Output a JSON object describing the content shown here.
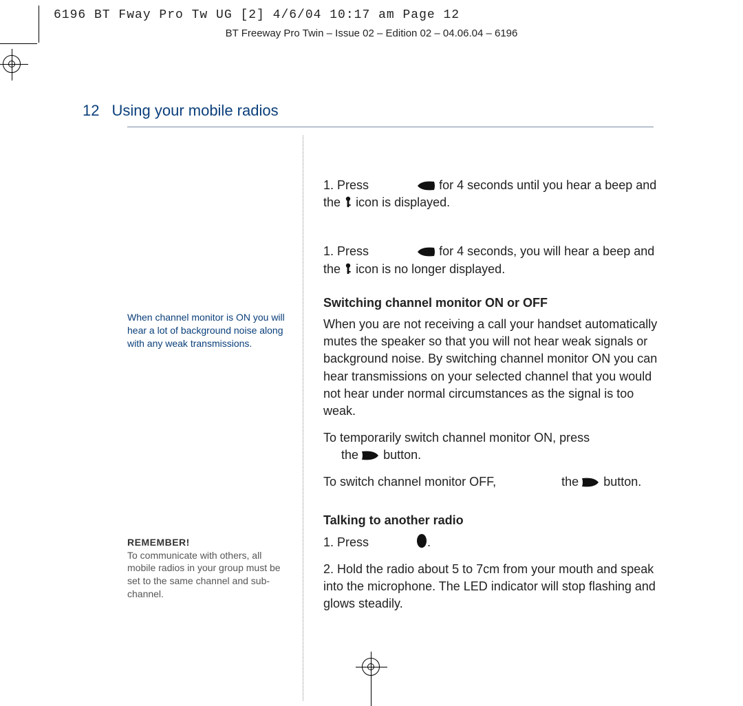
{
  "print": {
    "slug": "6196 BT Fway Pro Tw UG [2]  4/6/04  10:17 am  Page 12",
    "header": "BT Freeway Pro Twin – Issue 02 – Edition 02 – 04.06.04 – 6196"
  },
  "page": {
    "number": "12",
    "section_title": "Using your mobile radios"
  },
  "sidebar": {
    "note1": "When channel monitor is ON you will hear a lot of background noise along with any weak transmissions.",
    "remember_title": "REMEMBER!",
    "remember_body": "To communicate with others, all mobile radios in your group must be set to the same channel and sub-channel."
  },
  "main": {
    "step1a_prefix": "1. Press",
    "step1a_mid": "for 4 seconds until you hear a beep and the",
    "step1a_suffix": "icon is displayed.",
    "step1b_prefix": "1. Press",
    "step1b_mid": "for 4 seconds, you will hear a beep and the",
    "step1b_suffix": "icon is no longer displayed.",
    "h_switch": "Switching channel monitor ON or OFF",
    "switch_body": "When you are not receiving a call your handset automatically mutes the speaker so that you will not hear weak signals or background noise. By switching channel monitor ON you can hear transmissions on your selected channel that you would not hear under normal circumstances as the signal is too weak.",
    "switch_on_a": "To temporarily switch channel monitor ON, press",
    "switch_on_b": "the",
    "switch_on_c": "button.",
    "switch_off_a": "To switch channel monitor OFF,",
    "switch_off_b": "the",
    "switch_off_c": "button.",
    "h_talk": "Talking to another radio",
    "talk1": "1. Press",
    "talk1_end": ".",
    "talk2": "2. Hold the radio about 5 to 7cm from your mouth and speak into the microphone. The LED indicator will stop flashing and glows steadily."
  },
  "icons": {
    "mode": "mode-button-icon",
    "key": "key-lock-icon",
    "monitor": "monitor-button-icon",
    "ptt": "ptt-button-icon"
  }
}
